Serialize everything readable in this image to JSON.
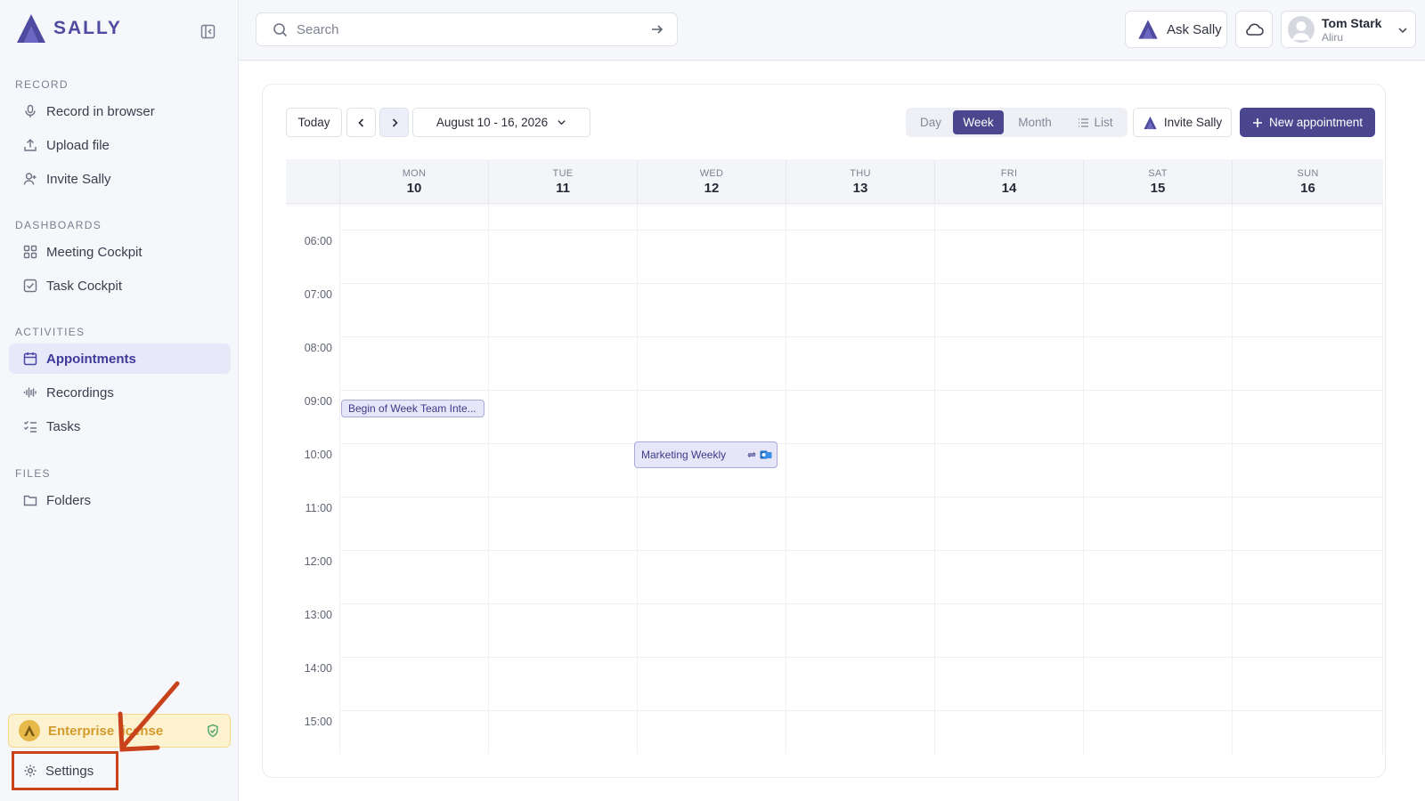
{
  "brand": {
    "name": "SALLY",
    "accent": "#4f4ba0"
  },
  "search": {
    "placeholder": "Search"
  },
  "sidebar": {
    "sections": [
      {
        "label": "RECORD",
        "items": [
          {
            "label": "Record in browser",
            "icon": "microphone-icon"
          },
          {
            "label": "Upload file",
            "icon": "upload-icon"
          },
          {
            "label": "Invite Sally",
            "icon": "user-plus-icon"
          }
        ]
      },
      {
        "label": "DASHBOARDS",
        "items": [
          {
            "label": "Meeting Cockpit",
            "icon": "grid-icon"
          },
          {
            "label": "Task Cockpit",
            "icon": "checkbox-icon"
          }
        ]
      },
      {
        "label": "ACTIVITIES",
        "items": [
          {
            "label": "Appointments",
            "icon": "calendar-icon",
            "active": true
          },
          {
            "label": "Recordings",
            "icon": "waveform-icon"
          },
          {
            "label": "Tasks",
            "icon": "checklist-icon"
          }
        ]
      },
      {
        "label": "FILES",
        "items": [
          {
            "label": "Folders",
            "icon": "folder-icon"
          }
        ]
      }
    ],
    "license_label": "Enterprise license",
    "settings_label": "Settings"
  },
  "header": {
    "ask_label": "Ask Sally",
    "user": {
      "name": "Tom Stark",
      "org": "Aliru"
    }
  },
  "calendar": {
    "today_label": "Today",
    "date_range": "August 10 - 16, 2026",
    "views": [
      "Day",
      "Week",
      "Month",
      "List"
    ],
    "active_view": "Week",
    "invite_label": "Invite Sally",
    "new_label": "New appointment",
    "days": [
      {
        "dow": "MON",
        "num": "10"
      },
      {
        "dow": "TUE",
        "num": "11"
      },
      {
        "dow": "WED",
        "num": "12"
      },
      {
        "dow": "THU",
        "num": "13"
      },
      {
        "dow": "FRI",
        "num": "14"
      },
      {
        "dow": "SAT",
        "num": "15"
      },
      {
        "dow": "SUN",
        "num": "16"
      }
    ],
    "hours": [
      "06:00",
      "07:00",
      "08:00",
      "09:00",
      "10:00",
      "11:00",
      "12:00",
      "13:00",
      "14:00",
      "15:00"
    ],
    "events": [
      {
        "title": "Begin of Week Team Inte...",
        "day": "MON",
        "start": "09:00"
      },
      {
        "title": "Marketing Weekly",
        "day": "WED",
        "start": "10:00",
        "icons": [
          "recurring-icon",
          "outlook-icon"
        ]
      }
    ]
  },
  "colors": {
    "primary": "#4a478f",
    "license_bg": "#fdf2cf",
    "annotation": "#c8421b"
  }
}
